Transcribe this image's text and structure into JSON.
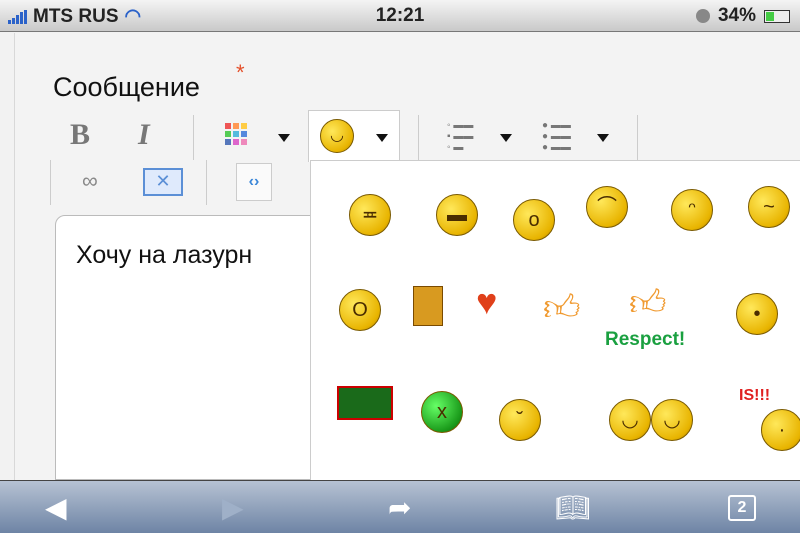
{
  "status_bar": {
    "carrier": "MTS RUS",
    "time": "12:21",
    "battery": "34%",
    "battery_level": 0.34
  },
  "form": {
    "label": "Сообщение",
    "required_mark": "*"
  },
  "toolbar": {
    "bold": "B",
    "italic": "I"
  },
  "editor": {
    "text": "Хочу на лазурн"
  },
  "emoji_popup": {
    "respect_label": "Respect!",
    "is_label": "IS!!!"
  },
  "browser_bar": {
    "tabs_count": "2"
  }
}
